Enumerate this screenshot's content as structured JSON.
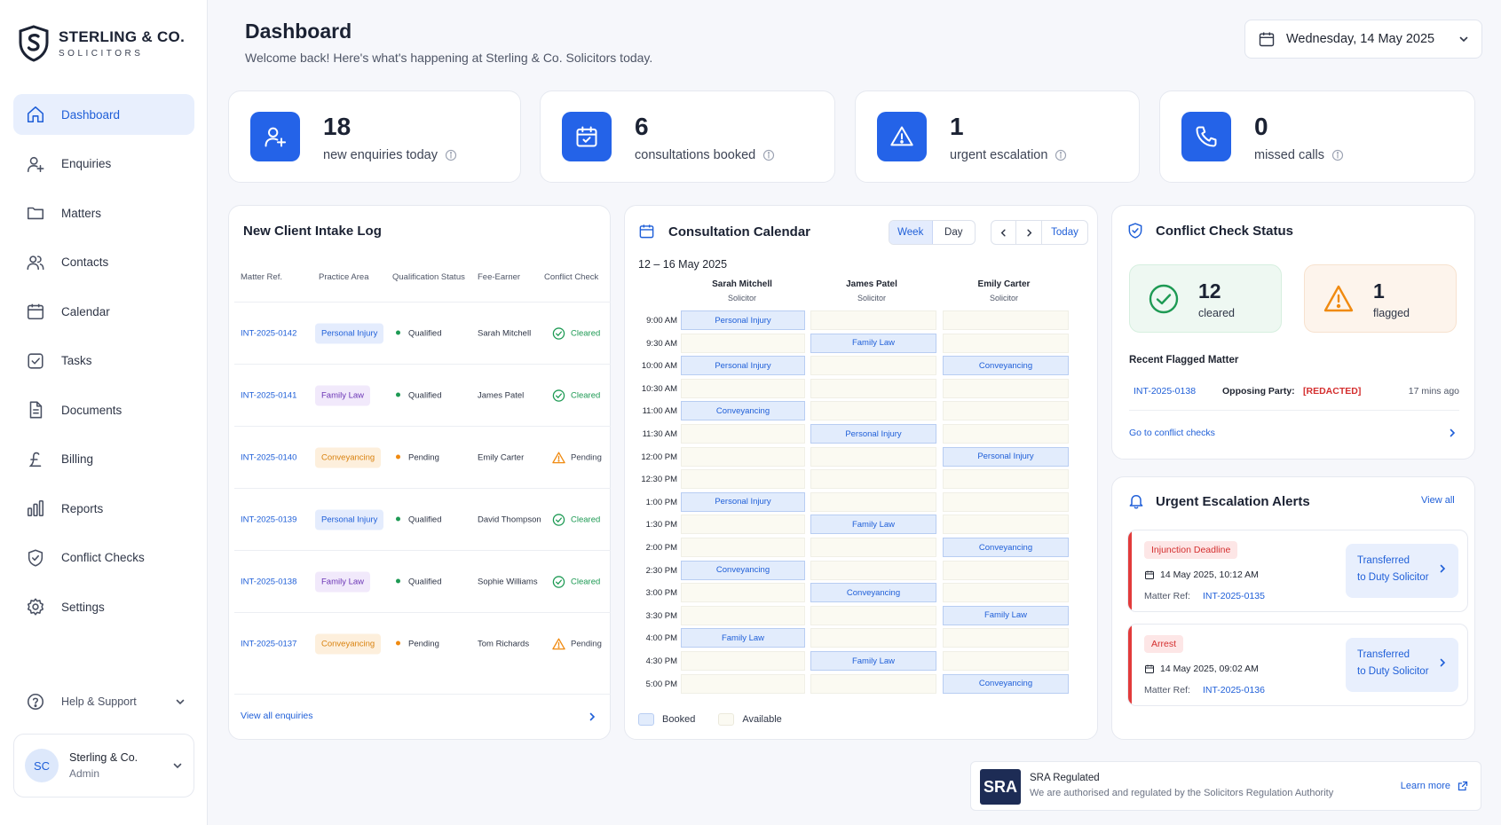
{
  "brand": {
    "name": "STERLING & CO.",
    "sub": "SOLICITORS"
  },
  "nav": [
    {
      "label": "Dashboard",
      "icon": "home-icon",
      "active": true
    },
    {
      "label": "Enquiries",
      "icon": "user-plus-icon"
    },
    {
      "label": "Matters",
      "icon": "folder-icon"
    },
    {
      "label": "Contacts",
      "icon": "users-icon"
    },
    {
      "label": "Calendar",
      "icon": "calendar-icon"
    },
    {
      "label": "Tasks",
      "icon": "checkbox-icon"
    },
    {
      "label": "Documents",
      "icon": "document-icon"
    },
    {
      "label": "Billing",
      "icon": "pound-icon"
    },
    {
      "label": "Reports",
      "icon": "bar-chart-icon"
    },
    {
      "label": "Conflict Checks",
      "icon": "shield-icon"
    },
    {
      "label": "Settings",
      "icon": "gear-icon"
    }
  ],
  "help": {
    "label": "Help & Support"
  },
  "user": {
    "initials": "SC",
    "name": "Sterling & Co.",
    "role": "Admin"
  },
  "header": {
    "title": "Dashboard",
    "subtitle": "Welcome back! Here's what's happening at Sterling & Co. Solicitors today.",
    "date": "Wednesday, 14 May 2025"
  },
  "stats": [
    {
      "value": "18",
      "label": "new enquiries today"
    },
    {
      "value": "6",
      "label": "consultations booked"
    },
    {
      "value": "1",
      "label": "urgent escalation"
    },
    {
      "value": "0",
      "label": "missed calls"
    }
  ],
  "intake": {
    "title": "New Client Intake Log",
    "columns": [
      "Matter Ref.",
      "Practice Area",
      "Qualification Status",
      "Fee-Earner",
      "Conflict Check"
    ],
    "rows": [
      {
        "ref": "INT-2025-0142",
        "area": "Personal Injury",
        "areaKind": "pi",
        "status": "Qualified",
        "earner": "Sarah Mitchell",
        "check": "Cleared"
      },
      {
        "ref": "INT-2025-0141",
        "area": "Family Law",
        "areaKind": "fl",
        "status": "Qualified",
        "earner": "James Patel",
        "check": "Cleared"
      },
      {
        "ref": "INT-2025-0140",
        "area": "Conveyancing",
        "areaKind": "cv",
        "status": "Pending",
        "earner": "Emily Carter",
        "check": "Pending"
      },
      {
        "ref": "INT-2025-0139",
        "area": "Personal Injury",
        "areaKind": "pi",
        "status": "Qualified",
        "earner": "David Thompson",
        "check": "Cleared"
      },
      {
        "ref": "INT-2025-0138",
        "area": "Family Law",
        "areaKind": "fl",
        "status": "Qualified",
        "earner": "Sophie Williams",
        "check": "Cleared"
      },
      {
        "ref": "INT-2025-0137",
        "area": "Conveyancing",
        "areaKind": "cv",
        "status": "Pending",
        "earner": "Tom Richards",
        "check": "Pending"
      }
    ],
    "view_all": "View all enquiries"
  },
  "calendar": {
    "title": "Consultation Calendar",
    "view_week": "Week",
    "view_day": "Day",
    "today": "Today",
    "range": "12 – 16 May 2025",
    "people": [
      {
        "name": "Sarah Mitchell",
        "role": "Solicitor"
      },
      {
        "name": "James Patel",
        "role": "Solicitor"
      },
      {
        "name": "Emily Carter",
        "role": "Solicitor"
      }
    ],
    "times": [
      "9:00 AM",
      "9:30 AM",
      "10:00 AM",
      "10:30 AM",
      "11:00 AM",
      "11:30 AM",
      "12:00 PM",
      "12:30 PM",
      "1:00 PM",
      "1:30 PM",
      "2:00 PM",
      "2:30 PM",
      "3:00 PM",
      "3:30 PM",
      "4:00 PM",
      "4:30 PM",
      "5:00 PM"
    ],
    "events": [
      {
        "col": 0,
        "slot": 0,
        "label": "Personal Injury"
      },
      {
        "col": 1,
        "slot": 1,
        "label": "Family Law"
      },
      {
        "col": 0,
        "slot": 2,
        "label": "Personal Injury"
      },
      {
        "col": 2,
        "slot": 2,
        "label": "Conveyancing"
      },
      {
        "col": 0,
        "slot": 4,
        "label": "Conveyancing"
      },
      {
        "col": 1,
        "slot": 5,
        "label": "Personal Injury"
      },
      {
        "col": 2,
        "slot": 6,
        "label": "Personal Injury"
      },
      {
        "col": 0,
        "slot": 8,
        "label": "Personal Injury"
      },
      {
        "col": 1,
        "slot": 9,
        "label": "Family Law"
      },
      {
        "col": 2,
        "slot": 10,
        "label": "Conveyancing"
      },
      {
        "col": 0,
        "slot": 11,
        "label": "Conveyancing"
      },
      {
        "col": 1,
        "slot": 12,
        "label": "Conveyancing"
      },
      {
        "col": 2,
        "slot": 13,
        "label": "Family Law"
      },
      {
        "col": 0,
        "slot": 14,
        "label": "Family Law"
      },
      {
        "col": 1,
        "slot": 15,
        "label": "Family Law"
      },
      {
        "col": 2,
        "slot": 16,
        "label": "Conveyancing"
      }
    ],
    "legend_booked": "Booked",
    "legend_available": "Available"
  },
  "conflict": {
    "title": "Conflict Check Status",
    "cleared_value": "12",
    "cleared_label": "cleared",
    "flagged_value": "1",
    "flagged_label": "flagged",
    "recent_title": "Recent Flagged Matter",
    "recent_ref": "INT-2025-0138",
    "party_label": "Opposing Party:",
    "party_value": "[REDACTED]",
    "recent_time": "17 mins ago",
    "go_link": "Go to conflict checks"
  },
  "escalations": {
    "title": "Urgent Escalation Alerts",
    "view_all": "View all",
    "matter_label": "Matter Ref:",
    "items": [
      {
        "tag": "Injunction Deadline",
        "when": "14 May 2025, 10:12 AM",
        "ref": "INT-2025-0135",
        "action1": "Transferred",
        "action2": "to Duty Solicitor"
      },
      {
        "tag": "Arrest",
        "when": "14 May 2025, 09:02 AM",
        "ref": "INT-2025-0136",
        "action1": "Transferred",
        "action2": "to Duty Solicitor"
      }
    ]
  },
  "sra": {
    "logo": "SRA",
    "title": "SRA Regulated",
    "subtitle": "We are authorised and regulated by the Solicitors Regulation Authority",
    "link": "Learn more"
  }
}
